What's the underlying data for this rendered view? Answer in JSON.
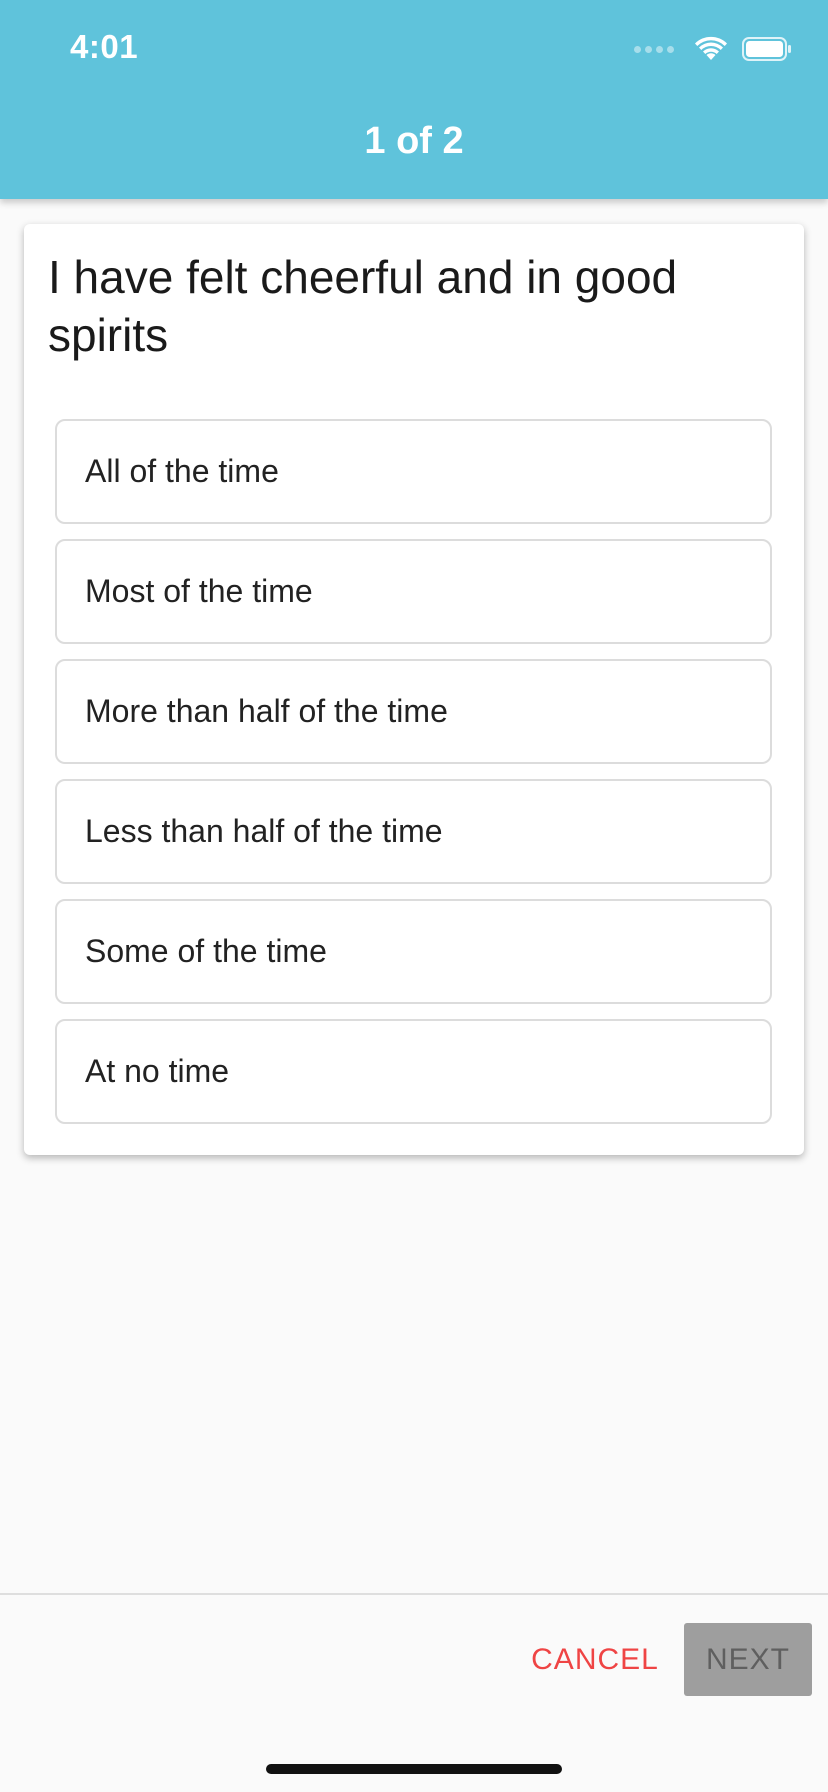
{
  "status_bar": {
    "time": "4:01",
    "icons": [
      "signal-icon",
      "wifi-icon",
      "battery-icon"
    ]
  },
  "header": {
    "title": "1 of 2",
    "background_color": "#5fc3db"
  },
  "question": {
    "text": "I have felt cheerful and in good spirits",
    "options": [
      {
        "label": "All of the time"
      },
      {
        "label": "Most of the time"
      },
      {
        "label": "More than half of the time"
      },
      {
        "label": "Less than half of the time"
      },
      {
        "label": "Some of the time"
      },
      {
        "label": "At no time"
      }
    ]
  },
  "footer": {
    "cancel_label": "CANCEL",
    "next_label": "NEXT",
    "cancel_color": "#ef4444",
    "next_disabled": true
  }
}
